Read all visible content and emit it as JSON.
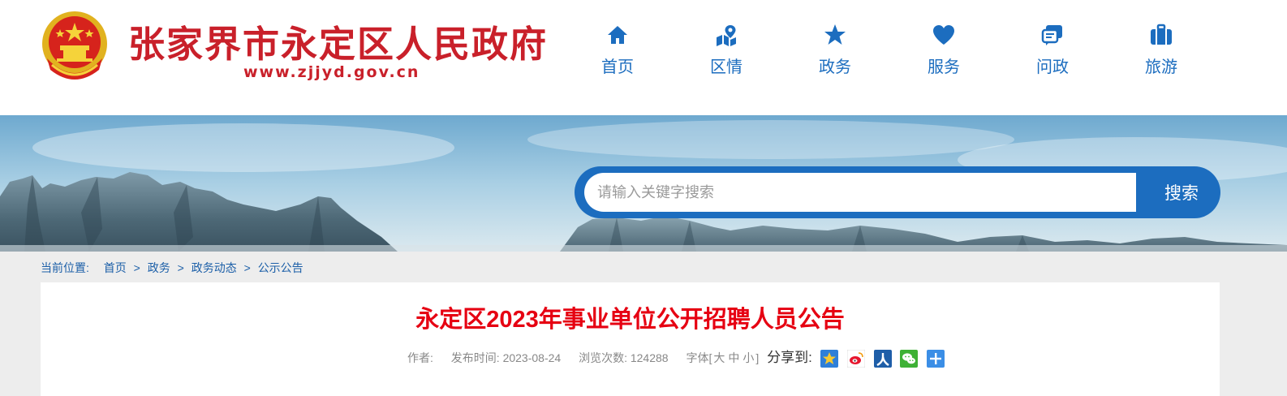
{
  "site": {
    "name": "张家界市永定区人民政府",
    "url": "www.zjjyd.gov.cn"
  },
  "nav": {
    "items": [
      {
        "label": "首页",
        "icon": "home-icon"
      },
      {
        "label": "区情",
        "icon": "map-location-icon"
      },
      {
        "label": "政务",
        "icon": "star-icon"
      },
      {
        "label": "服务",
        "icon": "heart-icon"
      },
      {
        "label": "问政",
        "icon": "chat-icon"
      },
      {
        "label": "旅游",
        "icon": "luggage-icon"
      }
    ]
  },
  "search": {
    "placeholder": "请输入关键字搜索",
    "button_label": "搜索"
  },
  "breadcrumb": {
    "label": "当前位置:",
    "items": [
      "首页",
      "政务",
      "政务动态",
      "公示公告"
    ],
    "separator": ">"
  },
  "article": {
    "title": "永定区2023年事业单位公开招聘人员公告",
    "author_label": "作者:",
    "publish_label": "发布时间:",
    "publish_date": "2023-08-24",
    "views_label": "浏览次数:",
    "views": "124288",
    "font_label": "字体[",
    "font_large": "大",
    "font_medium": "中",
    "font_small": "小",
    "font_close": "]",
    "share_label": "分享到:",
    "share_targets": [
      "qzone-icon",
      "weibo-icon",
      "renren-icon",
      "wechat-icon",
      "more-share-icon"
    ]
  },
  "colors": {
    "brand_red": "#c9202a",
    "brand_blue": "#1c6dbf",
    "title_red": "#e60012"
  }
}
